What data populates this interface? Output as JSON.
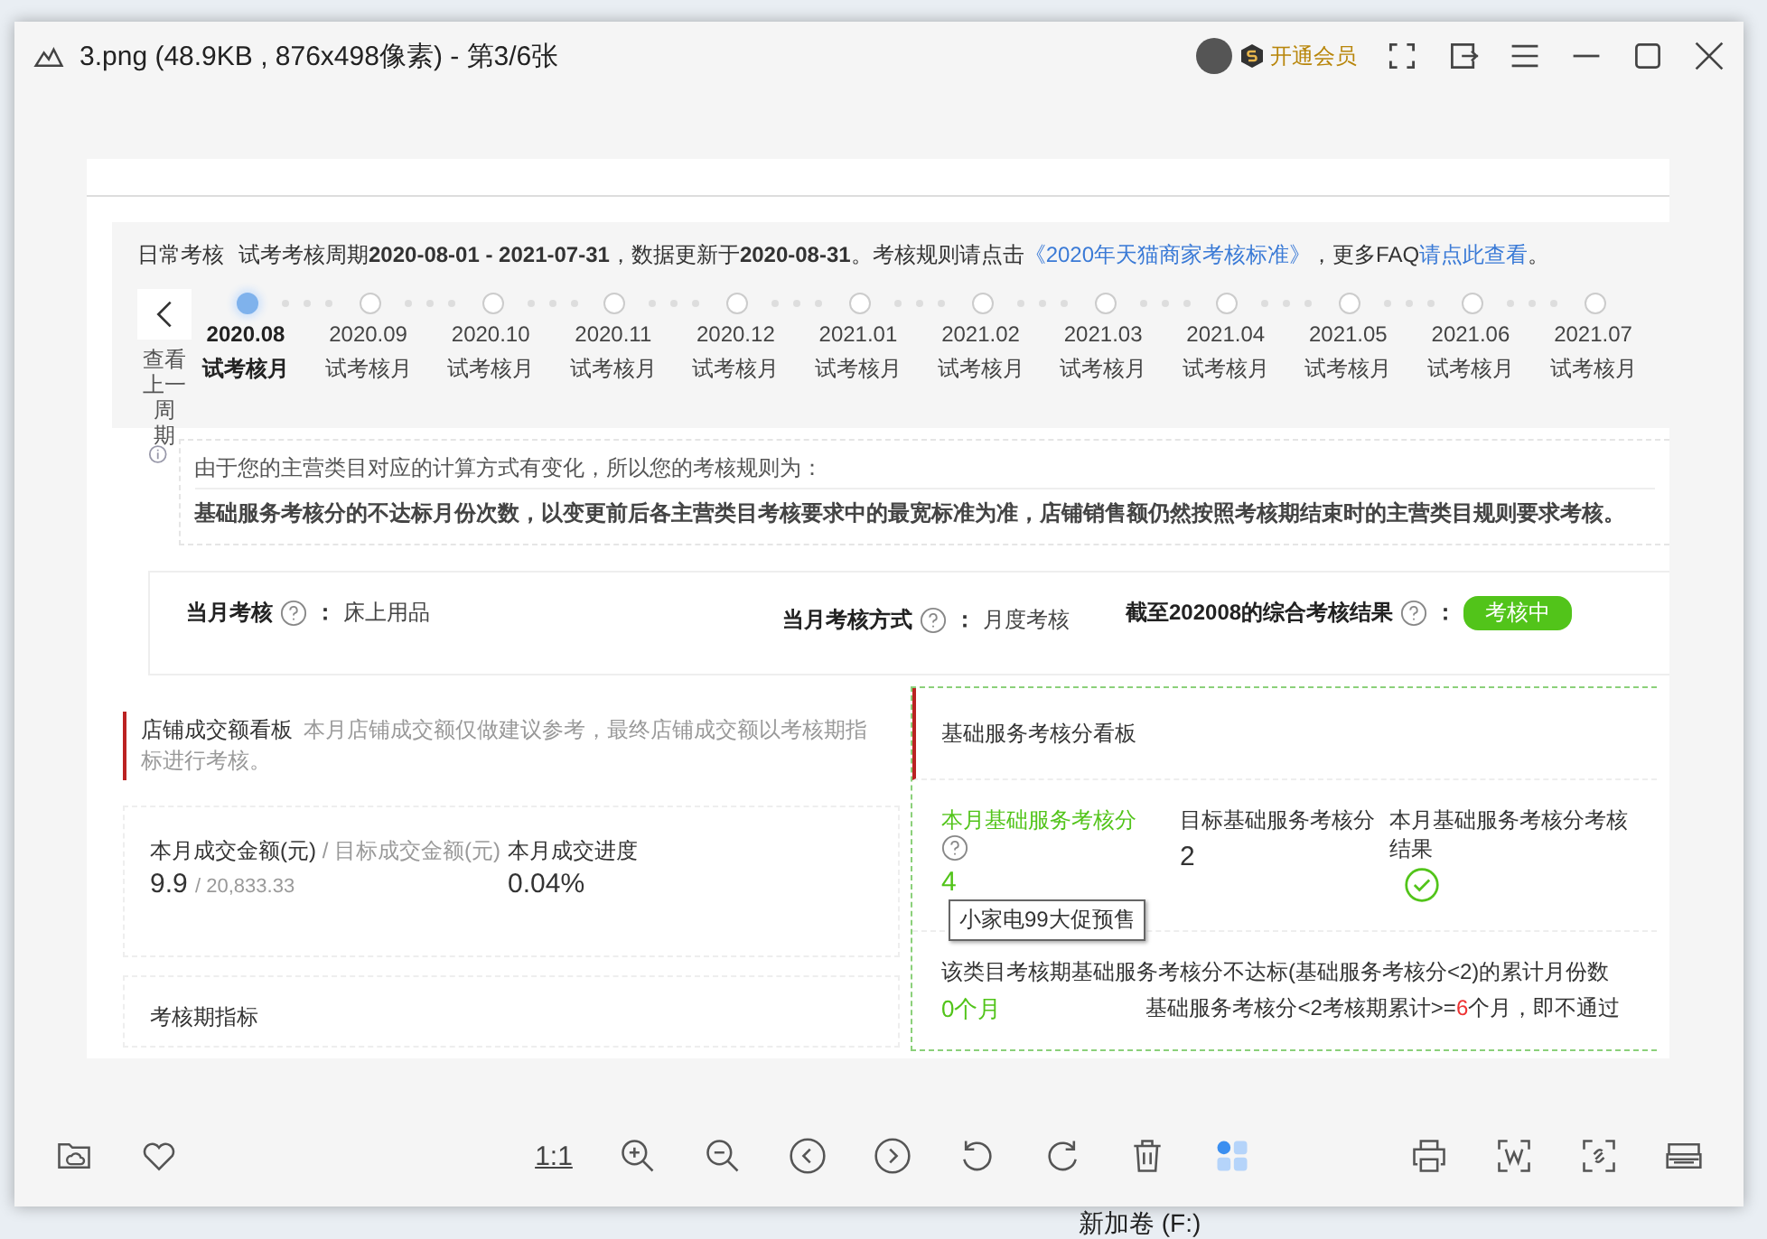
{
  "window": {
    "title": "3.png (48.9KB , 876x498像素) - 第3/6张",
    "vip_label": "开通会员"
  },
  "image": {
    "header": {
      "label": "日常考核",
      "text": "试考考核周期**2020-08-01 - 2021-07-31**，数据更新于**2020-08-31**。考核规则请点击",
      "link1": "《2020年天猫商家考核标准》",
      "middle": "，更多FAQ",
      "link2": "请点此查看",
      "end": "。"
    },
    "prev_button": [
      "查看",
      "上一周",
      "期"
    ],
    "months": [
      {
        "date": "2020.08",
        "label": "试考核月",
        "selected": true
      },
      {
        "date": "2020.09",
        "label": "试考核月",
        "selected": false
      },
      {
        "date": "2020.10",
        "label": "试考核月",
        "selected": false
      },
      {
        "date": "2020.11",
        "label": "试考核月",
        "selected": false
      },
      {
        "date": "2020.12",
        "label": "试考核月",
        "selected": false
      },
      {
        "date": "2021.01",
        "label": "试考核月",
        "selected": false
      },
      {
        "date": "2021.02",
        "label": "试考核月",
        "selected": false
      },
      {
        "date": "2021.03",
        "label": "试考核月",
        "selected": false
      },
      {
        "date": "2021.04",
        "label": "试考核月",
        "selected": false
      },
      {
        "date": "2021.05",
        "label": "试考核月",
        "selected": false
      },
      {
        "date": "2021.06",
        "label": "试考核月",
        "selected": false
      },
      {
        "date": "2021.07",
        "label": "试考核月",
        "selected": false
      }
    ],
    "notice": {
      "line1": "由于您的主营类目对应的计算方式有变化，所以您的考核规则为：",
      "line2": "基础服务考核分的不达标月份次数，以变更前后各主营类目考核要求中的最宽标准为准，店铺销售额仍然按照考核期结束时的主营类目规则要求考核。"
    },
    "summary": [
      {
        "label": "当月考核",
        "separator": "：",
        "value": "床上用品",
        "kind": "text"
      },
      {
        "label": "当月考核方式",
        "separator": "：",
        "value": "月度考核",
        "kind": "text"
      },
      {
        "label": "截至202008的综合考核结果",
        "separator": "：",
        "value": "考核中",
        "kind": "badge"
      }
    ],
    "sales_board": {
      "title": "店铺成交额看板",
      "note": "本月店铺成交额仅做建议参考，最终店铺成交额以考核期指标进行考核。",
      "amount_label": "本月成交金额(元)",
      "target_label": "/ 目标成交金额(元)",
      "amount": "9.9",
      "target_separator": "/",
      "target": "20,833.33",
      "progress_label": "本月成交进度",
      "progress": "0.04%",
      "period_label": "考核期指标"
    },
    "service_board": {
      "title": "基础服务考核分看板",
      "score_label": "本月基础服务考核分",
      "score": "4",
      "target_label": "目标基础服务考核分",
      "target": "2",
      "result_label": "本月基础服务考核分考核结果",
      "passed": true,
      "tooltip": "小家电99大促预售",
      "count_label": "该类目考核期基础服务考核分不达标(基础服务考核分<2)的累计月份数",
      "count": "0个月",
      "rule_before": "基础服务考核分<2考核期累计>=",
      "rule_number": "6",
      "rule_after": "个月，即不通过"
    }
  },
  "toolbar": {
    "actual_size": "1:1"
  },
  "desktop": {
    "drive_label": "新加卷 (F:)"
  }
}
